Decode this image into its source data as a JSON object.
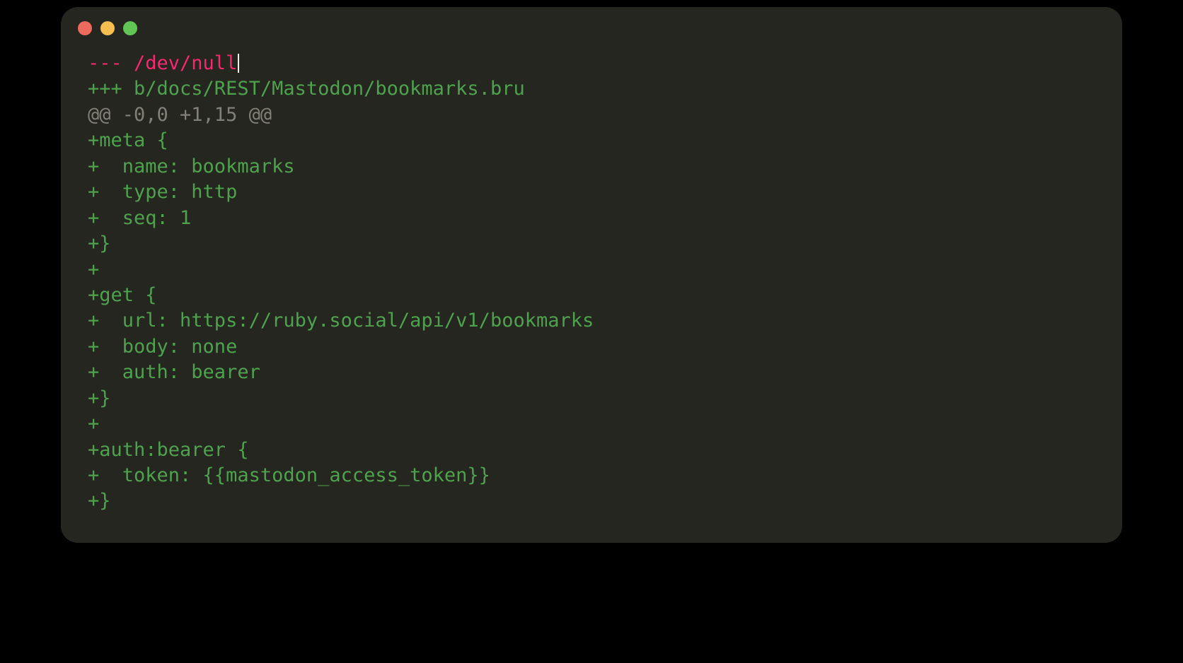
{
  "lines": [
    {
      "cls": "removed",
      "text": "--- /dev/null",
      "cursor": true
    },
    {
      "cls": "added",
      "text": "+++ b/docs/REST/Mastodon/bookmarks.bru"
    },
    {
      "cls": "hunk",
      "text": "@@ -0,0 +1,15 @@"
    },
    {
      "cls": "added",
      "text": "+meta {"
    },
    {
      "cls": "added",
      "text": "+  name: bookmarks"
    },
    {
      "cls": "added",
      "text": "+  type: http"
    },
    {
      "cls": "added",
      "text": "+  seq: 1"
    },
    {
      "cls": "added",
      "text": "+}"
    },
    {
      "cls": "added",
      "text": "+"
    },
    {
      "cls": "added",
      "text": "+get {"
    },
    {
      "cls": "added",
      "text": "+  url: https://ruby.social/api/v1/bookmarks"
    },
    {
      "cls": "added",
      "text": "+  body: none"
    },
    {
      "cls": "added",
      "text": "+  auth: bearer"
    },
    {
      "cls": "added",
      "text": "+}"
    },
    {
      "cls": "added",
      "text": "+"
    },
    {
      "cls": "added",
      "text": "+auth:bearer {"
    },
    {
      "cls": "added",
      "text": "+  token: {{mastodon_access_token}}"
    },
    {
      "cls": "added",
      "text": "+}"
    }
  ]
}
